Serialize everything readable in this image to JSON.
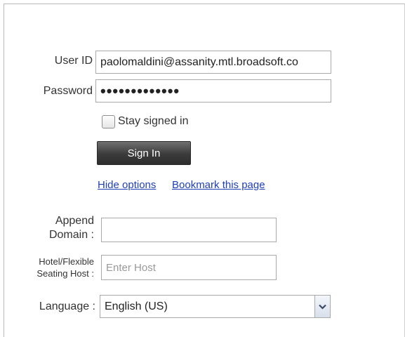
{
  "form": {
    "user_id_label": "User ID",
    "user_id_value": "paolomaldini@assanity.mtl.broadsoft.co",
    "password_label": "Password",
    "password_masked": "•••••••••••••",
    "stay_signed_in_label": "Stay signed in",
    "sign_in_label": "Sign In",
    "hide_options_label": "Hide options",
    "bookmark_label": "Bookmark this page",
    "append_domain_label_line1": "Append",
    "append_domain_label_line2": "Domain :",
    "append_domain_value": "",
    "hotel_label_line1": "Hotel/Flexible",
    "hotel_label_line2": "Seating Host :",
    "host_placeholder": "Enter Host",
    "language_label": "Language :",
    "language_value": "English (US)"
  },
  "icons": {
    "dropdown": "chevron-down-icon"
  },
  "colors": {
    "link": "#1f3fb8",
    "button": "#3b3b3b"
  }
}
